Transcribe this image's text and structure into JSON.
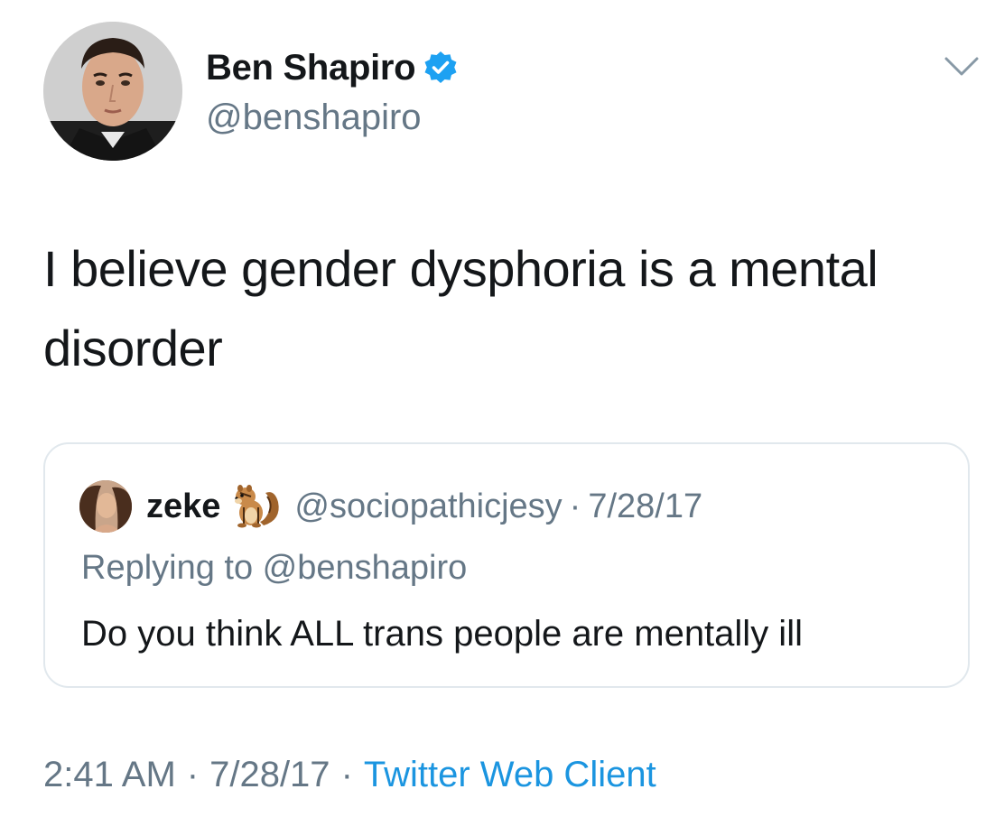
{
  "author": {
    "display_name": "Ben Shapiro",
    "handle": "@benshapiro",
    "verified": true,
    "verified_icon": "verified-badge-icon",
    "avatar": "profile-photo"
  },
  "tweet": {
    "text": "I believe gender dysphoria is a mental disorder"
  },
  "quoted_tweet": {
    "display_name": "zeke",
    "name_emoji": "chipmunk-icon",
    "handle": "@sociopathicjesy",
    "separator": "·",
    "date": "7/28/17",
    "replying_to": "Replying to @benshapiro",
    "text": "Do you think ALL trans people are mentally ill"
  },
  "meta": {
    "time": "2:41 AM",
    "separator": "·",
    "date": "7/28/17",
    "client": "Twitter Web Client"
  },
  "colors": {
    "text_primary": "#14171a",
    "text_secondary": "#657786",
    "link": "#1b95e0",
    "verified": "#1da1f2",
    "border": "#e1e8ed"
  }
}
